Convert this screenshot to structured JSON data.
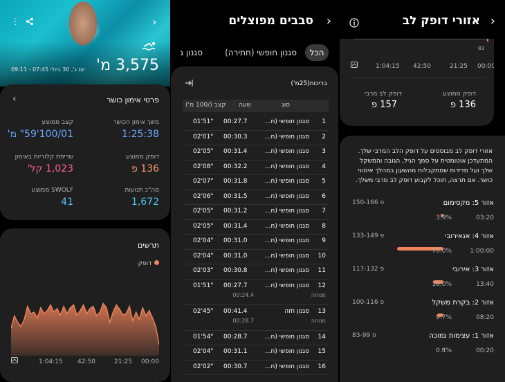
{
  "left_panel": {
    "distance": "3,575 מ'",
    "date_time": "יום ג', 30 ביולי 07:45 - 09:11",
    "details_title": "פרטי אימון כושר",
    "stats": [
      {
        "label": "משך אימון הכושר",
        "value": "1:25:38",
        "color": "#6aa9ff"
      },
      {
        "label": "קצב ממוצע",
        "value": "100/01'59\" מ'",
        "color": "#6aa9ff"
      },
      {
        "label": "דופק ממוצע",
        "value": "136 פ",
        "color": "#ff9a6a"
      },
      {
        "label": "שריפת קלוריות באימון",
        "value": "1,023 קל'",
        "color": "#ff5fa2"
      },
      {
        "label": "סה\"כ תנועות",
        "value": "1,672",
        "color": "#4fc3f7"
      },
      {
        "label": "SWOLF ממוצע",
        "value": "41",
        "color": "#4fc3f7"
      }
    ],
    "chart_title": "תרשים",
    "legend": "דופק",
    "x_ticks": [
      "00:00",
      "21:25",
      "42:50",
      "1:04:15"
    ]
  },
  "middle_panel": {
    "title": "סבבים מפוצלים",
    "tabs": [
      "הכל",
      "סגנון חופשי (חתירה)",
      "סגנון גו"
    ],
    "table_title": "בריכות(25מ')",
    "headers": [
      "סוג",
      "שעה",
      "קצב (/100 מ')"
    ],
    "rows": [
      {
        "n": "1",
        "type": "סגנון חופשי (ח...",
        "time": "00:27.7",
        "pace": "01'51\""
      },
      {
        "n": "2",
        "type": "סגנון חופשי (ח...",
        "time": "00:30.3",
        "pace": "02'01\""
      },
      {
        "n": "3",
        "type": "סגנון חופשי (ח...",
        "time": "00:31.4",
        "pace": "02'05\""
      },
      {
        "n": "4",
        "type": "סגנון חופשי (ח...",
        "time": "00:32.2",
        "pace": "02'08\""
      },
      {
        "n": "5",
        "type": "סגנון חופשי (ח...",
        "time": "00:31.8",
        "pace": "02'07\""
      },
      {
        "n": "6",
        "type": "סגנון חופשי (ח...",
        "time": "00:31.5",
        "pace": "02'06\""
      },
      {
        "n": "7",
        "type": "סגנון חופשי (ח...",
        "time": "00:31.2",
        "pace": "02'05\""
      },
      {
        "n": "8",
        "type": "סגנון חופשי (ח...",
        "time": "00:31.4",
        "pace": "02'05\""
      },
      {
        "n": "9",
        "type": "סגנון חופשי (ח...",
        "time": "00:31.0",
        "pace": "02'04\""
      },
      {
        "n": "10",
        "type": "סגנון חופשי (ח...",
        "time": "00:31.0",
        "pace": "02'04\""
      },
      {
        "n": "11",
        "type": "סגנון חופשי (ח...",
        "time": "00:30.8",
        "pace": "02'03\""
      },
      {
        "n": "12",
        "type": "סגנון חופשי (ח...",
        "time": "00:27.7",
        "pace": "01'51\"",
        "rest_label": "מנוחה",
        "rest": "00:24.4"
      },
      {
        "n": "13",
        "type": "סגנון חזה",
        "time": "00:41.4",
        "pace": "02'45\"",
        "rest_label": "מנוחה",
        "rest": "00:28.7"
      },
      {
        "n": "14",
        "type": "סגנון חופשי (ח...",
        "time": "00:28.7",
        "pace": "01'54\""
      },
      {
        "n": "15",
        "type": "סגנון חופשי (ח...",
        "time": "00:31.1",
        "pace": "02'04\""
      },
      {
        "n": "16",
        "type": "סגנון חופשי (ח...",
        "time": "00:30.7",
        "pace": "02'02\""
      }
    ]
  },
  "right_panel": {
    "title": "אזורי דופק לב",
    "top_tick": "83",
    "x_ticks": [
      "00:00",
      "21:25",
      "42:50",
      "1:04:15"
    ],
    "avg_label": "דופק ממוצע",
    "avg_value": "136 פ",
    "max_label": "דופק לב מרבי",
    "max_value": "157 פ",
    "description": "אזורי דופק לב מבוססים על דופק הלב המרבי שלך. המתעדכן אוטומטית על סמך הגיל, הגובה והמשקל שלך ועל מדידות שמתקבלות מהשעון במהלך אימוני כושר. אם תרצה, תוכל לקבוע דופק לב מרבי משלך.",
    "zones": [
      {
        "name": "אזור 5: מקסימום",
        "range": "150-166 פ",
        "time": "03:20",
        "percent": "3.9%",
        "fraction": 0.039
      },
      {
        "name": "אזור 4: אנאירובי",
        "range": "133-149 פ",
        "time": "1:00:00",
        "percent": "70.0%",
        "fraction": 0.7
      },
      {
        "name": "אזור 3: אירובי",
        "range": "117-132 פ",
        "time": "13:40",
        "percent": "16.0%",
        "fraction": 0.16
      },
      {
        "name": "אזור 2: בקרת משקל",
        "range": "100-116 פ",
        "time": "08:20",
        "percent": "9.7%",
        "fraction": 0.097
      },
      {
        "name": "אזור 1: עצימות נמוכה",
        "range": "83-99 פ",
        "time": "00:20",
        "percent": "0.4%",
        "fraction": 0.004
      }
    ]
  },
  "colors": {
    "heart": "#f0835a",
    "accent_blue": "#6aa9ff",
    "pink": "#ff5fa2",
    "cyan": "#4fc3f7"
  },
  "chart_data": {
    "type": "area",
    "x_ticks": [
      "00:00",
      "21:25",
      "42:50",
      "1:04:15"
    ],
    "series": [
      {
        "name": "דופק",
        "values": [
          95,
          120,
          132,
          142,
          135,
          146,
          130,
          140,
          128,
          148,
          138,
          136,
          144,
          150,
          140,
          126,
          146,
          152,
          140,
          135,
          148,
          145,
          138,
          150,
          142,
          136,
          150,
          146,
          138,
          148,
          136,
          145,
          140,
          150,
          142,
          138,
          146,
          132,
          140,
          138,
          148,
          130,
          120,
          126,
          135,
          118
        ]
      }
    ]
  }
}
